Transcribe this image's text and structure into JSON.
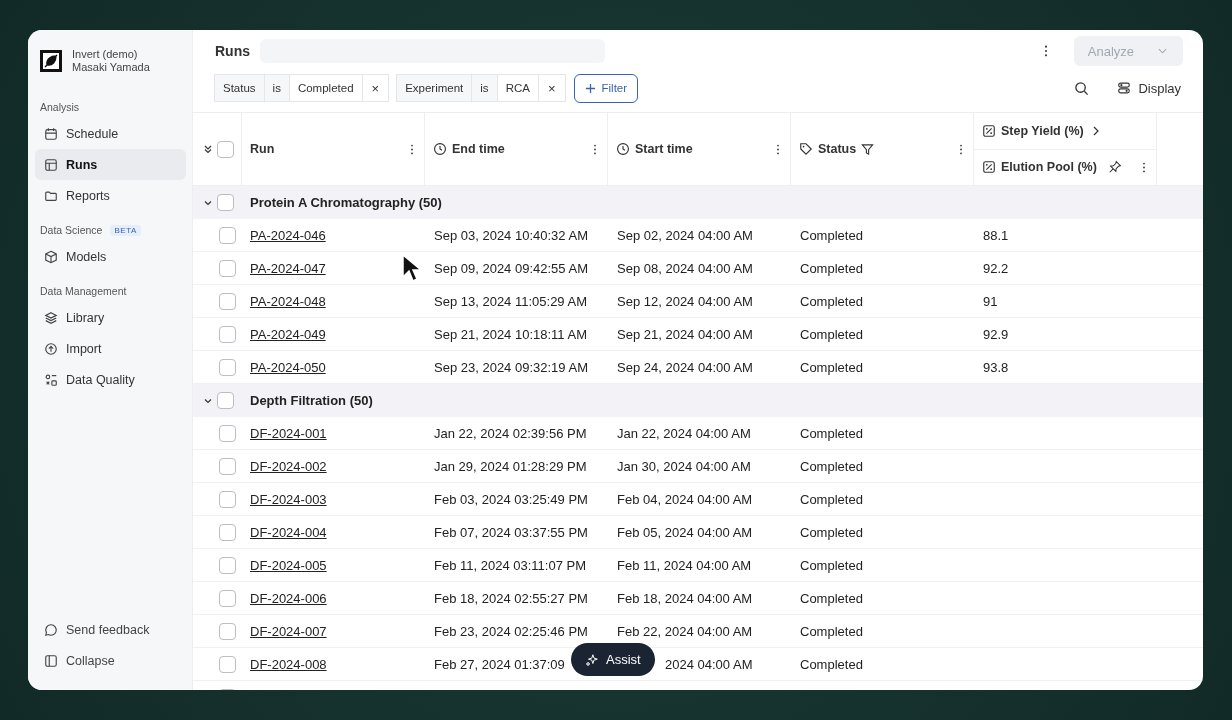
{
  "org": {
    "name": "Invert (demo)",
    "user": "Masaki Yamada"
  },
  "sidebar": {
    "sections": [
      {
        "title": "Analysis",
        "items": [
          {
            "label": "Schedule",
            "selected": false
          },
          {
            "label": "Runs",
            "selected": true
          },
          {
            "label": "Reports",
            "selected": false
          }
        ]
      },
      {
        "title": "Data Science",
        "badge": "BETA",
        "items": [
          {
            "label": "Models",
            "selected": false
          }
        ]
      },
      {
        "title": "Data Management",
        "items": [
          {
            "label": "Library",
            "selected": false
          },
          {
            "label": "Import",
            "selected": false
          },
          {
            "label": "Data Quality",
            "selected": false
          }
        ]
      }
    ],
    "footer": [
      {
        "label": "Send feedback"
      },
      {
        "label": "Collapse"
      }
    ]
  },
  "page_title": "Runs",
  "analyze_button": {
    "label": "Analyze",
    "disabled": true
  },
  "filters": [
    {
      "field": "Status",
      "op": "is",
      "value": "Completed",
      "remove": "×"
    },
    {
      "field": "Experiment",
      "op": "is",
      "value": "RCA",
      "remove": "×"
    }
  ],
  "filter_button": "Filter",
  "display_button": "Display",
  "select_all_checked": false,
  "columns": [
    {
      "label": "Run"
    },
    {
      "label": "End time"
    },
    {
      "label": "Start time"
    },
    {
      "label": "Status"
    }
  ],
  "yield_column": {
    "label": "Step Yield (%)",
    "sub_label": "Elution Pool (%)"
  },
  "groups": [
    {
      "name": "Protein A Chromatography (50)",
      "expanded": true,
      "checked": false,
      "rows": [
        {
          "checked": false,
          "run": "PA-2024-046",
          "end": "Sep 03, 2024 10:40:32 AM",
          "start": "Sep 02, 2024 04:00 AM",
          "status": "Completed",
          "yield": "88.1"
        },
        {
          "checked": false,
          "run": "PA-2024-047",
          "end": "Sep 09, 2024 09:42:55 AM",
          "start": "Sep 08, 2024 04:00 AM",
          "status": "Completed",
          "yield": "92.2"
        },
        {
          "checked": false,
          "run": "PA-2024-048",
          "end": "Sep 13, 2024 11:05:29 AM",
          "start": "Sep 12, 2024 04:00 AM",
          "status": "Completed",
          "yield": "91"
        },
        {
          "checked": false,
          "run": "PA-2024-049",
          "end": "Sep 21, 2024 10:18:11 AM",
          "start": "Sep 21, 2024 04:00 AM",
          "status": "Completed",
          "yield": "92.9"
        },
        {
          "checked": false,
          "run": "PA-2024-050",
          "end": "Sep 23, 2024 09:32:19 AM",
          "start": "Sep 24, 2024 04:00 AM",
          "status": "Completed",
          "yield": "93.8"
        }
      ]
    },
    {
      "name": "Depth Filtration (50)",
      "expanded": true,
      "checked": false,
      "rows": [
        {
          "checked": false,
          "run": "DF-2024-001",
          "end": "Jan 22, 2024 02:39:56 PM",
          "start": "Jan 22, 2024 04:00 AM",
          "status": "Completed"
        },
        {
          "checked": false,
          "run": "DF-2024-002",
          "end": "Jan 29, 2024 01:28:29 PM",
          "start": "Jan 30, 2024 04:00 AM",
          "status": "Completed"
        },
        {
          "checked": false,
          "run": "DF-2024-003",
          "end": "Feb 03, 2024 03:25:49 PM",
          "start": "Feb 04, 2024 04:00 AM",
          "status": "Completed"
        },
        {
          "checked": false,
          "run": "DF-2024-004",
          "end": "Feb 07, 2024 03:37:55 PM",
          "start": "Feb 05, 2024 04:00 AM",
          "status": "Completed"
        },
        {
          "checked": false,
          "run": "DF-2024-005",
          "end": "Feb 11, 2024 03:11:07 PM",
          "start": "Feb 11, 2024 04:00 AM",
          "status": "Completed"
        },
        {
          "checked": false,
          "run": "DF-2024-006",
          "end": "Feb 18, 2024 02:55:27 PM",
          "start": "Feb 18, 2024 04:00 AM",
          "status": "Completed"
        },
        {
          "checked": false,
          "run": "DF-2024-007",
          "end": "Feb 23, 2024 02:25:46 PM",
          "start": "Feb 22, 2024 04:00 AM",
          "status": "Completed"
        },
        {
          "checked": false,
          "run": "DF-2024-008",
          "end": "Feb 27, 2024 01:37:09",
          "start": "2024 04:00 AM",
          "status": "Completed"
        }
      ]
    }
  ],
  "assist_button": "Assist"
}
